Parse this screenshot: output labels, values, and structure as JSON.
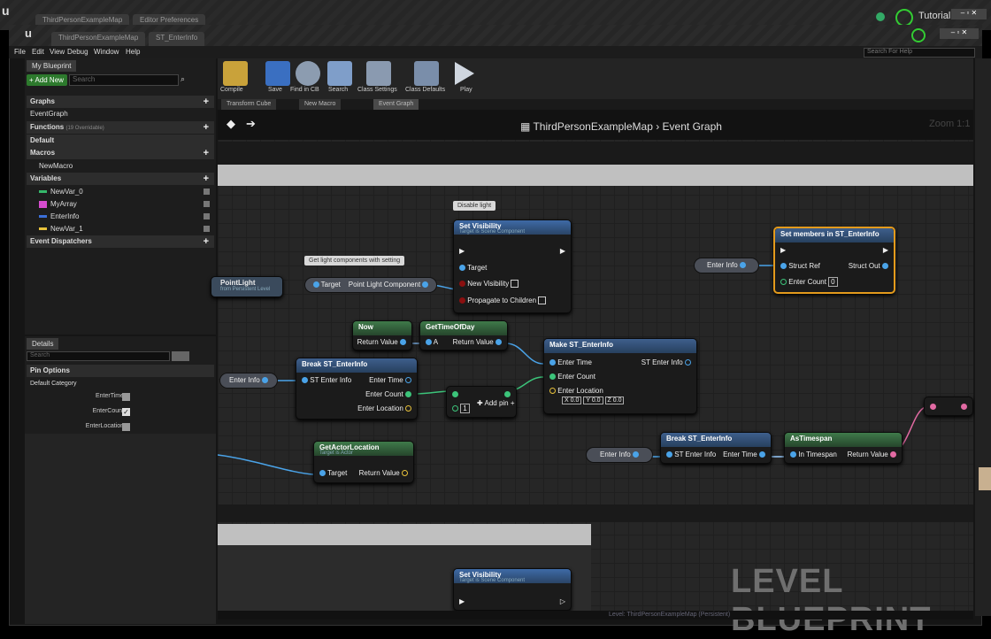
{
  "outer": {
    "tabs": [
      "ThirdPersonExampleMap",
      "Editor Preferences"
    ],
    "tutorial": "Tutorial"
  },
  "inner": {
    "tabs": [
      "ThirdPersonExampleMap",
      "ST_EnterInfo"
    ],
    "search_placeholder": "Search For Help"
  },
  "menu": [
    "File",
    "Edit",
    "View",
    "Debug",
    "Window",
    "Help"
  ],
  "mybp": {
    "tab": "My Blueprint",
    "add_new": "+ Add New",
    "search": "Search",
    "graphs": "Graphs",
    "event_graph": "EventGraph",
    "functions": "Functions",
    "functions_note": "(19 Overridable)",
    "default": "Default",
    "macros": "Macros",
    "new_macro": "NewMacro",
    "variables": "Variables",
    "vars": [
      "NewVar_0",
      "MyArray",
      "EnterInfo",
      "NewVar_1"
    ],
    "var_colors": [
      "#35b86a",
      "#d64ccf",
      "#3b6fd8",
      "#e8c23b"
    ],
    "event_dispatchers": "Event Dispatchers"
  },
  "details": {
    "tab": "Details",
    "search": "Search",
    "pin_options": "Pin Options",
    "default_category": "Default Category",
    "fields": [
      "EnterTime",
      "EnterCount",
      "EnterLocation"
    ],
    "checked": [
      false,
      true,
      false
    ]
  },
  "toolbar": {
    "labels": [
      "Compile",
      "Save",
      "Find in CB",
      "Search",
      "Class Settings",
      "Class Defaults",
      "Play"
    ]
  },
  "doc_tabs": [
    "Transform Cube",
    "New Macro",
    "Event Graph"
  ],
  "graph": {
    "breadcrumb_map": "ThirdPersonExampleMap",
    "breadcrumb_graph": "Event Graph",
    "zoom": "Zoom 1:1",
    "watermark": "LEVEL BLUEPRINT"
  },
  "nodes": {
    "comment_disable": "Disable light",
    "set_vis": {
      "title": "Set Visibility",
      "sub": "Target is Scene Component",
      "target": "Target",
      "new_vis": "New Visibility",
      "propagate": "Propagate to Children"
    },
    "comment_get": "Get light components with setting",
    "pointlight": {
      "title": "PointLight",
      "sub": "from Persistent Level"
    },
    "target_plc": {
      "target": "Target",
      "out": "Point Light Component"
    },
    "enter_info": "Enter Info",
    "set_members": {
      "title": "Set members in ST_EnterInfo",
      "struct_ref": "Struct Ref",
      "struct_out": "Struct Out",
      "enter_count": "Enter Count",
      "enter_count_val": "0"
    },
    "now": {
      "title": "Now",
      "out": "Return Value"
    },
    "gettod": {
      "title": "GetTimeOfDay",
      "a": "A",
      "out": "Return Value"
    },
    "make": {
      "title": "Make ST_EnterInfo",
      "enter_time": "Enter Time",
      "out": "ST Enter Info",
      "enter_count": "Enter Count",
      "enter_location": "Enter Location",
      "x": "X",
      "xv": "0.0",
      "y": "Y",
      "yv": "0.0",
      "z": "Z",
      "zv": "0.0"
    },
    "break1": {
      "title": "Break ST_EnterInfo",
      "in": "ST Enter Info",
      "enter_time": "Enter Time",
      "enter_count": "Enter Count",
      "enter_location": "Enter Location"
    },
    "add": {
      "val": "1",
      "add_pin": "Add pin"
    },
    "getactor": {
      "title": "GetActorLocation",
      "sub": "Target is Actor",
      "target": "Target",
      "out": "Return Value"
    },
    "break2": {
      "title": "Break ST_EnterInfo",
      "in": "ST Enter Info",
      "out": "Enter Time"
    },
    "astimespan": {
      "title": "AsTimespan",
      "in": "In Timespan",
      "out": "Return Value"
    },
    "set_vis2": {
      "title": "Set Visibility",
      "sub": "Target is Scene Component"
    }
  },
  "status": "Level: ThirdPersonExampleMap (Persistent)"
}
